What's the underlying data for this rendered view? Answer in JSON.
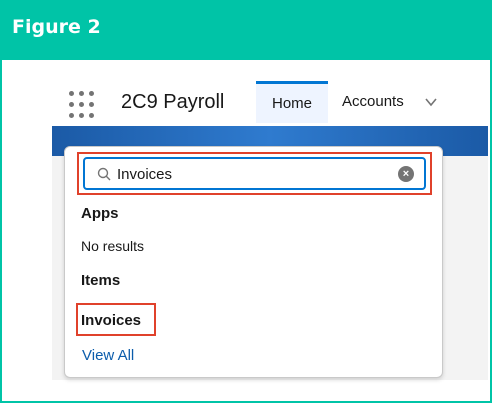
{
  "figure": {
    "title": "Figure 2",
    "accent_color": "#00c4a7"
  },
  "app_bar": {
    "app_name": "2C9 Payroll",
    "tabs": [
      {
        "label": "Home",
        "active": true
      },
      {
        "label": "Accounts"
      }
    ],
    "waffle_icon": "app-launcher-icon",
    "dropdown_icon": "chevron-down-icon"
  },
  "search": {
    "value": "Invoices",
    "clear_icon": "clear-icon",
    "search_icon": "search-icon",
    "highlight_color": "#e0412b"
  },
  "results": {
    "apps_heading": "Apps",
    "apps_empty": "No results",
    "items_heading": "Items",
    "items": [
      {
        "label": "Invoices"
      }
    ],
    "view_all": "View All"
  }
}
